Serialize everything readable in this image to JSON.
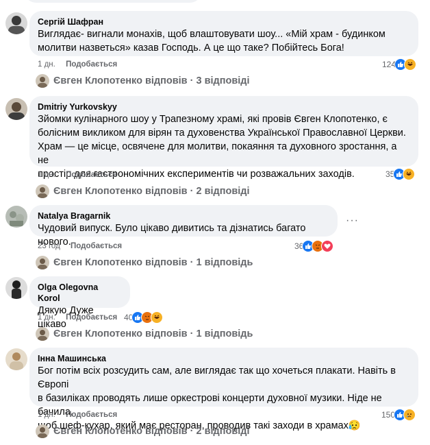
{
  "comments": [
    {
      "author": "Сергій Шафран",
      "lines": [
        "Виглядає- вигнали монахів, щоб влаштовувати шоу... «Мій храм - будинком",
        "молитви назветься» казав Господь. А це що таке? Побійтесь Бога!"
      ],
      "time": "1 дн.",
      "action": "Подобається",
      "reaction_count": "124",
      "reactions": [
        "like-icon",
        "haha-icon"
      ],
      "reply": {
        "text": "Євген Клопотенко відповів · 3 відповіді"
      },
      "avatar_color": "#3a3a3a"
    },
    {
      "author": "Dmitriy Yurkovskyy",
      "lines": [
        "Зйомки кулінарного шоу у Трапезному храмі, які провів Євген Клопотенко, є",
        "болісним викликом для вірян та духовенства Української Православної Церкви.",
        "Храм — це місце, освячене для молитви, покаяння та духовного зростання, а не",
        "простір для гастрономічних експериментів чи розважальних заходів."
      ],
      "time": "1 дн.",
      "action": "Подобається",
      "reaction_count": "35",
      "reactions": [
        "like-icon",
        "haha-icon"
      ],
      "reply": {
        "text": "Євген Клопотенко відповів · 2 відповіді"
      },
      "avatar_color": "#5a4a3a"
    },
    {
      "author": "Natalya Bragarnik",
      "lines": [
        "Чудовий випуск. Було цікаво дивитись та дізнатись багато нового."
      ],
      "time": "23 год",
      "action": "Подобається",
      "reaction_count": "36",
      "reactions": [
        "like-icon",
        "angry-icon",
        "love-icon"
      ],
      "reply": {
        "text": "Євген Клопотенко відповів · 1 відповідь"
      },
      "more": "···",
      "avatar_color": "#9aa39a"
    },
    {
      "author": "Olga Olegovna Korol",
      "lines": [
        "Дякую Дуже цікаво"
      ],
      "time": "1 дн.",
      "action": "Подобається",
      "reaction_count": "40",
      "reactions": [
        "like-icon",
        "angry-icon",
        "haha-icon"
      ],
      "reply": {
        "text": "Євген Клопотенко відповів · 1 відповідь"
      },
      "avatar_color": "#2a2a2a"
    },
    {
      "author": "Інна Машинська",
      "lines": [
        "Бог потім всіх розсудить сам, але виглядає так що хочеться плакати. Навіть в Європі",
        "в базиліках проводять лише оркестрові концерти духовної музики. Ніде не бачила,",
        "щоб шеф-кухар, який має ресторан, проводив такі заходи в храмах😥"
      ],
      "time": "1 дн.",
      "action": "Подобається",
      "reaction_count": "150",
      "reactions": [
        "like-icon",
        "sad-icon"
      ],
      "reply": {
        "text": "Євген Клопотенко відповів · 2 відповіді"
      },
      "avatar_color": "#b9a58a"
    }
  ],
  "colors": {
    "like": "#1877f2",
    "haha": "#f7b125",
    "angry": "#e9710f",
    "love": "#f33e58",
    "sad": "#f7b125",
    "bubble": "#f0f2f5",
    "meta": "#65676b"
  }
}
